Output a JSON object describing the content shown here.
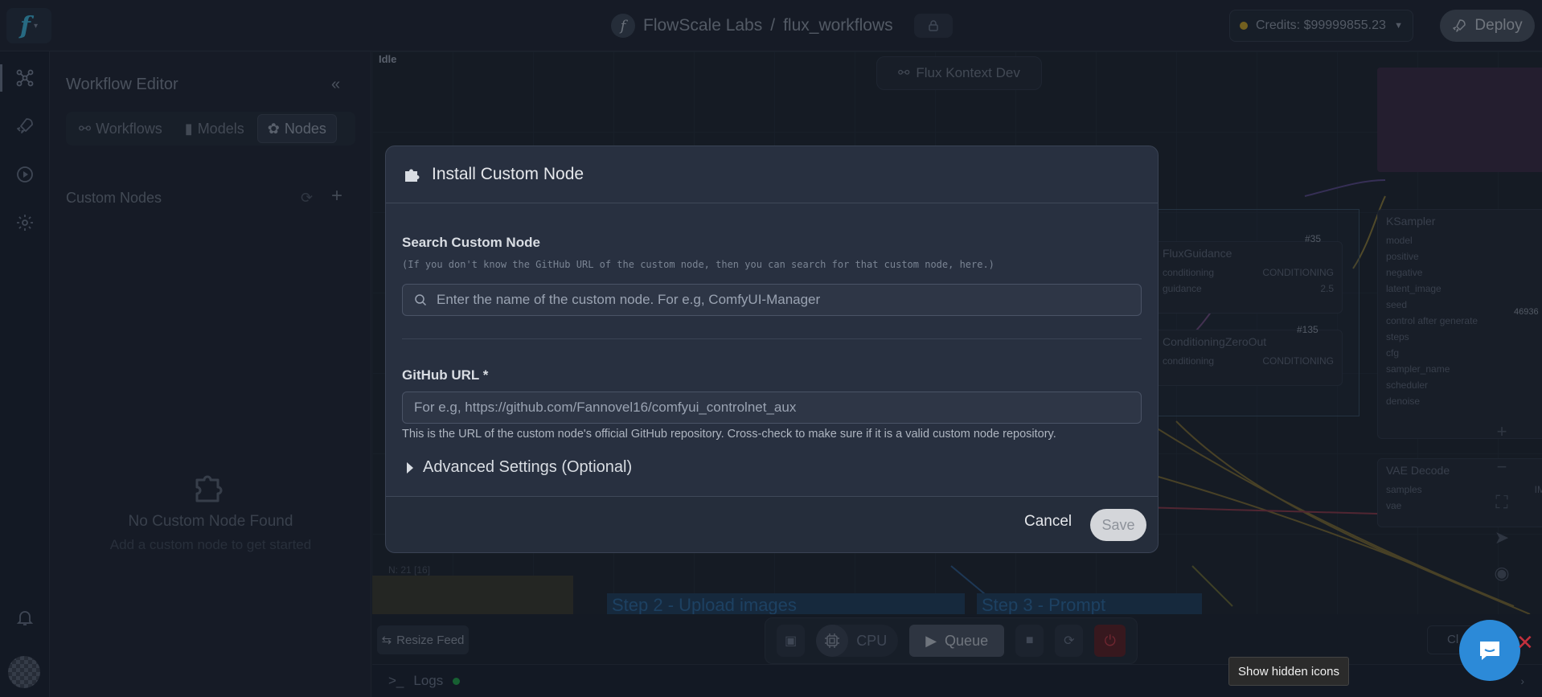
{
  "topbar": {
    "org": "FlowScale Labs",
    "separator": "/",
    "project": "flux_workflows",
    "credits": "Credits: $99999855.23",
    "deploy": "Deploy"
  },
  "sidebar": {
    "title": "Workflow Editor",
    "collapse": "«",
    "tabs": [
      {
        "label": "Workflows",
        "active": false
      },
      {
        "label": "Models",
        "active": false
      },
      {
        "label": "Nodes",
        "active": true
      }
    ],
    "section_title": "Custom Nodes",
    "empty_title": "No Custom Node Found",
    "empty_subtitle": "Add a custom node to get started"
  },
  "canvas": {
    "status": "Idle",
    "workflow_pill": "Flux Kontext Dev",
    "nodes": {
      "flux_guidance": {
        "title": "FluxGuidance",
        "in": "conditioning",
        "out": "CONDITIONING",
        "param": "guidance",
        "value": "2.5",
        "badge": "#35"
      },
      "zero_out": {
        "title": "ConditioningZeroOut",
        "in": "conditioning",
        "out": "CONDITIONING",
        "badge": "#135"
      },
      "ksampler": {
        "title": "KSampler",
        "inputs": [
          "model",
          "positive",
          "negative",
          "latent_image"
        ],
        "widgets": [
          "seed",
          "control after generate",
          "steps",
          "cfg",
          "sampler_name",
          "scheduler",
          "denoise"
        ],
        "seed_value": "46936"
      },
      "vae_decode": {
        "title": "VAE Decode",
        "inputs": [
          "samples",
          "vae"
        ],
        "out": "IM"
      }
    },
    "steps": {
      "step2": "Step 2 - Upload images",
      "step3": "Step 3 - Prompt"
    },
    "node_count": "N: 21 [16]"
  },
  "toolbar": {
    "resize_feed": "Resize Feed",
    "cpu": "CPU",
    "queue": "Queue",
    "close": "Cl"
  },
  "logs": {
    "label": "Logs",
    "prompt": ">_"
  },
  "modal": {
    "title": "Install Custom Node",
    "search_label": "Search Custom Node",
    "search_hint": "(If you don't know the GitHub URL of the custom node, then you can search for that custom node, here.)",
    "search_placeholder": "Enter the name of the custom node. For e.g, ComfyUI-Manager",
    "github_label": "GitHub URL *",
    "github_placeholder": "For e.g, https://github.com/Fannovel16/comfyui_controlnet_aux",
    "github_help": "This is the URL of the custom node's official GitHub repository. Cross-check to make sure if it is a valid custom node repository.",
    "advanced": "Advanced Settings (Optional)",
    "cancel": "Cancel",
    "save": "Save"
  },
  "tooltip": "Show hidden icons",
  "colors": {
    "accent": "#2c8ad8",
    "modal_bg": "#283040",
    "page_bg": "#1d2430",
    "danger": "#c4303d"
  }
}
